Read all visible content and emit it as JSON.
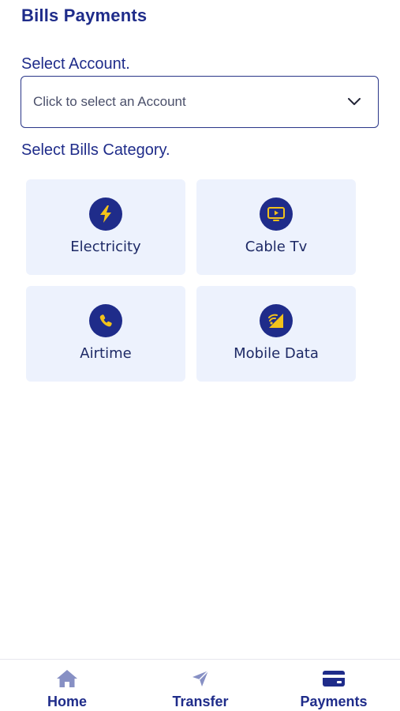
{
  "header": {
    "title": "Bills Payments"
  },
  "account": {
    "label": "Select Account.",
    "placeholder": "Click to select an Account",
    "icon": "chevron-down-icon"
  },
  "categories": {
    "label": "Select Bills Category.",
    "items": [
      {
        "label": "Electricity",
        "icon": "lightning-icon"
      },
      {
        "label": "Cable Tv",
        "icon": "tv-icon"
      },
      {
        "label": "Airtime",
        "icon": "phone-icon"
      },
      {
        "label": "Mobile Data",
        "icon": "mobile-data-icon"
      }
    ]
  },
  "bottom_nav": {
    "items": [
      {
        "label": "Home",
        "icon": "home-icon",
        "active": false
      },
      {
        "label": "Transfer",
        "icon": "send-icon",
        "active": false
      },
      {
        "label": "Payments",
        "icon": "card-icon",
        "active": true
      }
    ]
  },
  "colors": {
    "primary": "#1f2c8a",
    "card_bg": "#edf2fd",
    "icon_accent": "#f2c21b",
    "inactive_icon": "#8790c4"
  }
}
